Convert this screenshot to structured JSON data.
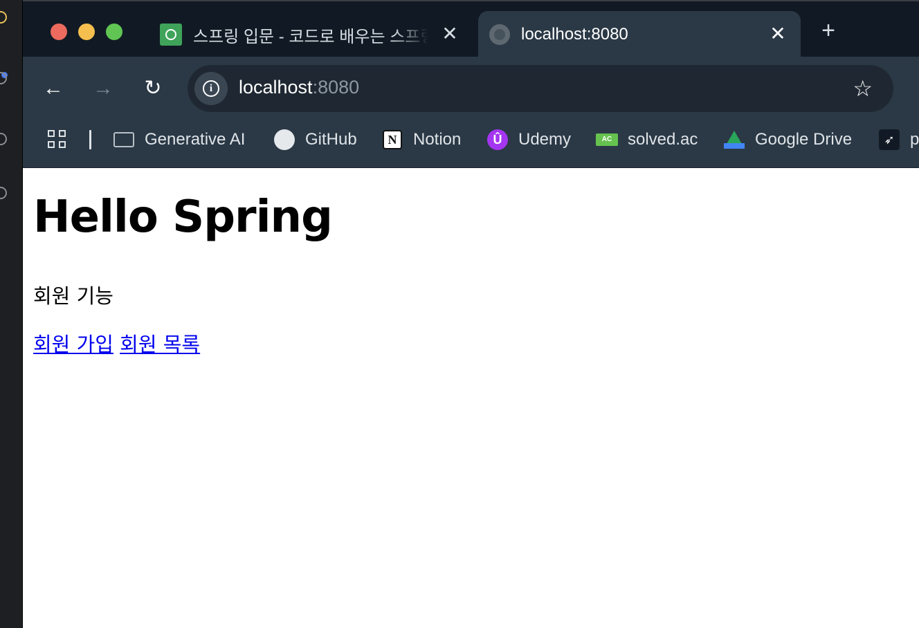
{
  "tabs": [
    {
      "title": "스프링 입문 - 코드로 배우는 스프링 부트, 웹 MVC, DB 접근 기술",
      "icon": "inflearn-icon",
      "active": false
    },
    {
      "title": "localhost:8080",
      "icon": "globe-icon",
      "active": true
    }
  ],
  "new_tab_label": "+",
  "close_label": "✕",
  "address": {
    "host": "localhost",
    "port": ":8080"
  },
  "bookmarks": [
    {
      "label": "Generative AI",
      "icon": "folder-icon"
    },
    {
      "label": "GitHub",
      "icon": "github-icon"
    },
    {
      "label": "Notion",
      "icon": "notion-icon",
      "glyph": "N"
    },
    {
      "label": "Udemy",
      "icon": "udemy-icon",
      "glyph": "Û"
    },
    {
      "label": "solved.ac",
      "icon": "solved-ac-icon",
      "glyph": "AC"
    },
    {
      "label": "Google Drive",
      "icon": "google-drive-icon"
    },
    {
      "label": "p",
      "icon": "bird-icon",
      "glyph": "➶"
    }
  ],
  "page": {
    "heading": "Hello Spring",
    "subtitle": "회원 기능",
    "links": [
      "회원 가입",
      "회원 목록"
    ]
  }
}
